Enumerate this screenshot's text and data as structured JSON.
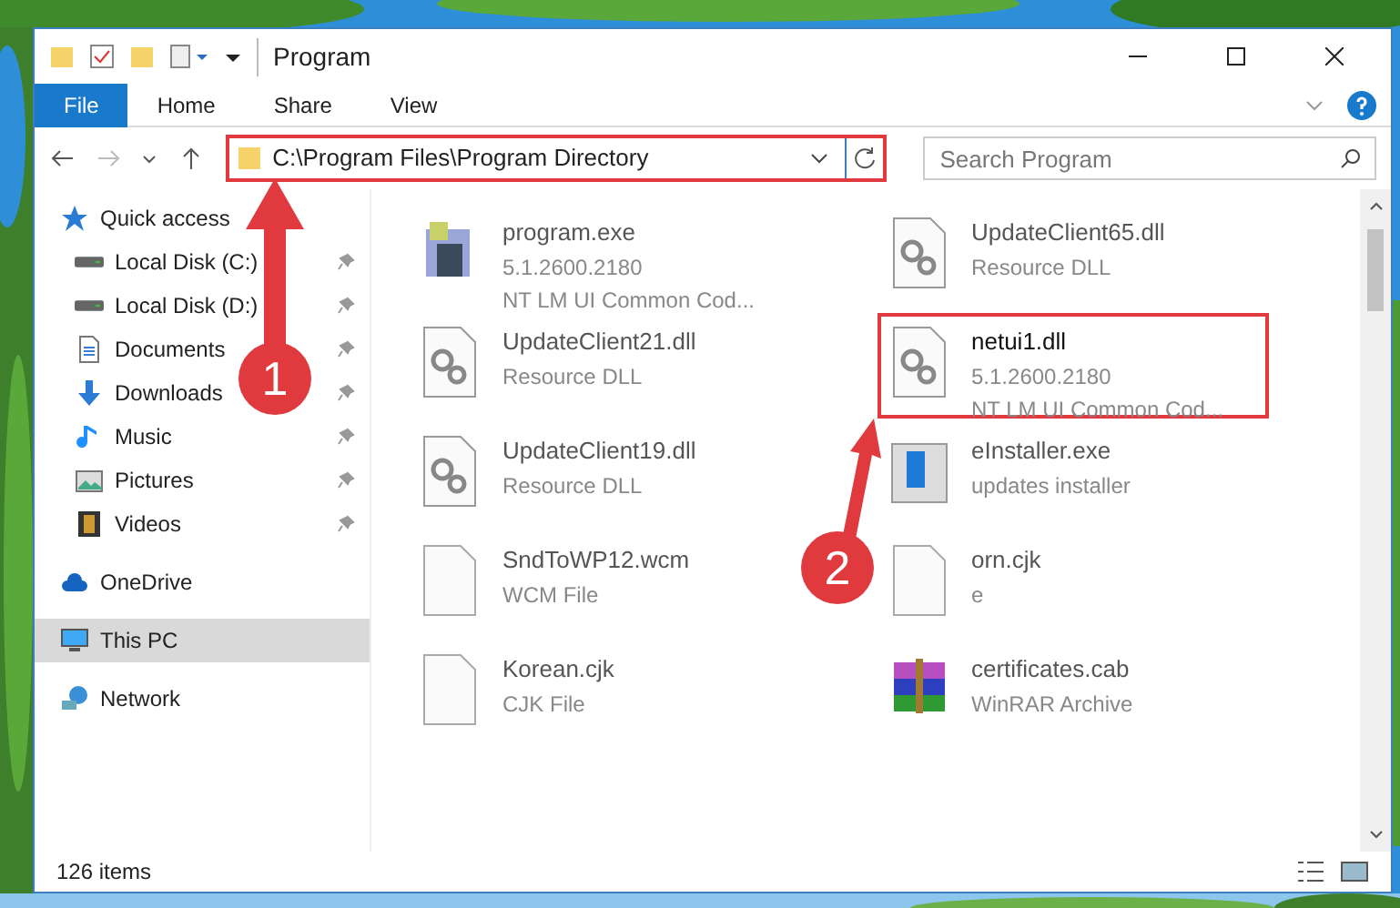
{
  "window": {
    "title": "Program"
  },
  "ribbon_tabs": [
    {
      "label": "File",
      "selected": true
    },
    {
      "label": "Home",
      "selected": false
    },
    {
      "label": "Share",
      "selected": false
    },
    {
      "label": "View",
      "selected": false
    }
  ],
  "address": {
    "value": "C:\\Program Files\\Program Directory",
    "highlighted": true
  },
  "search": {
    "placeholder": "Search Program"
  },
  "sidebar": {
    "items": [
      {
        "label": "Quick access",
        "kind": "star",
        "selected": false,
        "pinned": false,
        "children": [
          {
            "label": "Local Disk (C:)",
            "kind": "disk",
            "selected": false,
            "pinned": true
          },
          {
            "label": "Local Disk (D:)",
            "kind": "disk",
            "selected": false,
            "pinned": true
          },
          {
            "label": "Documents",
            "kind": "doc",
            "selected": false,
            "pinned": true
          },
          {
            "label": "Downloads",
            "kind": "download",
            "selected": false,
            "pinned": true
          },
          {
            "label": "Music",
            "kind": "music",
            "selected": false,
            "pinned": true
          },
          {
            "label": "Pictures",
            "kind": "pictures",
            "selected": false,
            "pinned": true
          },
          {
            "label": "Videos",
            "kind": "videos",
            "selected": false,
            "pinned": true
          }
        ]
      },
      {
        "label": "OneDrive",
        "kind": "cloud",
        "selected": false,
        "pinned": false
      },
      {
        "label": "This PC",
        "kind": "pc",
        "selected": true,
        "pinned": false
      },
      {
        "label": "Network",
        "kind": "network",
        "selected": false,
        "pinned": false
      }
    ]
  },
  "files": [
    {
      "name": "program.exe",
      "lines": [
        "5.1.2600.2180",
        "NT LM UI Common Cod..."
      ],
      "kind": "exe",
      "highlighted": false
    },
    {
      "name": "UpdateClient65.dll",
      "lines": [
        "Resource DLL"
      ],
      "kind": "dll",
      "highlighted": false
    },
    {
      "name": "UpdateClient21.dll",
      "lines": [
        "Resource DLL"
      ],
      "kind": "dll",
      "highlighted": false
    },
    {
      "name": "netui1.dll",
      "lines": [
        "5.1.2600.2180",
        "NT LM UI Common Cod..."
      ],
      "kind": "dll",
      "highlighted": true
    },
    {
      "name": "UpdateClient19.dll",
      "lines": [
        "Resource DLL"
      ],
      "kind": "dll",
      "highlighted": false
    },
    {
      "name": "eInstaller.exe",
      "lines": [
        "updates installer"
      ],
      "kind": "installer",
      "highlighted": false
    },
    {
      "name": "SndToWP12.wcm",
      "lines": [
        "WCM File"
      ],
      "kind": "file",
      "highlighted": false
    },
    {
      "name": "orn.cjk",
      "lines": [
        "e"
      ],
      "kind": "file",
      "highlighted": false
    },
    {
      "name": "Korean.cjk",
      "lines": [
        "CJK File"
      ],
      "kind": "file",
      "highlighted": false
    },
    {
      "name": "certificates.cab",
      "lines": [
        "WinRAR Archive"
      ],
      "kind": "archive",
      "highlighted": false
    }
  ],
  "annotations": [
    {
      "label": "1"
    },
    {
      "label": "2"
    }
  ],
  "status_bar": {
    "count": "126 items"
  }
}
